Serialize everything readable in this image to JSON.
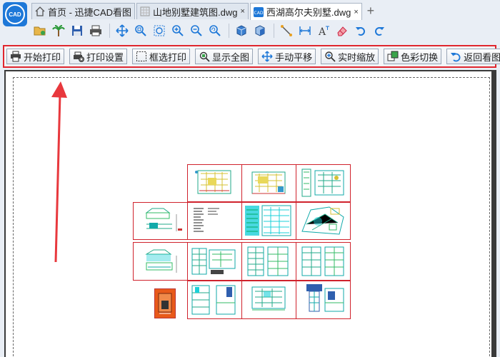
{
  "app": {
    "icon_label": "CAD"
  },
  "tabs": [
    {
      "label": "首页 - 迅捷CAD看图",
      "icon": "home-icon",
      "active": false,
      "closable": false
    },
    {
      "label": "山地别墅建筑图.dwg",
      "icon": "grid-icon",
      "active": false,
      "closable": true
    },
    {
      "label": "西湖高尔夫别墅.dwg",
      "icon": "cad-file-icon",
      "active": true,
      "closable": true
    }
  ],
  "close_glyph": "×",
  "new_tab_glyph": "+",
  "toolbar": [
    "open-folder-icon",
    "palm-tree-icon",
    "save-icon",
    "print-icon",
    "sep",
    "pan-icon",
    "zoom-window-icon",
    "zoom-extents-icon",
    "zoom-in-icon",
    "zoom-out-icon",
    "zoom-previous-icon",
    "sep",
    "3d-box-icon",
    "3d-view-icon",
    "sep",
    "line-icon",
    "dimension-icon",
    "text-icon",
    "eraser-icon",
    "undo-icon",
    "redo-icon"
  ],
  "print_toolbar": {
    "buttons": [
      {
        "label": "开始打印",
        "icon": "printer-icon"
      },
      {
        "label": "打印设置",
        "icon": "print-settings-icon"
      },
      {
        "label": "框选打印",
        "icon": "box-select-icon"
      },
      {
        "label": "显示全图",
        "icon": "show-all-icon"
      },
      {
        "label": "手动平移",
        "icon": "pan-move-icon"
      },
      {
        "label": "实时缩放",
        "icon": "realtime-zoom-icon"
      },
      {
        "label": "色彩切换",
        "icon": "color-switch-icon"
      },
      {
        "label": "返回看图",
        "icon": "return-view-icon"
      }
    ],
    "highlight_color": "#e0262e"
  },
  "colors": {
    "accent": "#1e78d8",
    "annotation_red": "#e8383d",
    "sheet_border": "#d0222c"
  }
}
